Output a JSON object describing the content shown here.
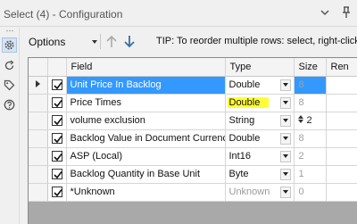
{
  "window": {
    "title": "Select (4) - Configuration"
  },
  "toolbar": {
    "options_label": "Options",
    "tip": "TIP: To reorder multiple rows: select, right-click an"
  },
  "grid": {
    "columns": [
      "Field",
      "Type",
      "Size",
      "Ren"
    ],
    "rows": [
      {
        "selected": true,
        "checked": true,
        "field": "Unit Price In Backlog",
        "type": "Double",
        "highlight": false,
        "type_disabled": false,
        "size": "8",
        "size_editable": false
      },
      {
        "selected": false,
        "checked": true,
        "field": "Price Times",
        "type": "Double",
        "highlight": true,
        "type_disabled": false,
        "size": "8",
        "size_editable": false
      },
      {
        "selected": false,
        "checked": true,
        "field": "volume exclusion",
        "type": "String",
        "highlight": false,
        "type_disabled": false,
        "size": "2",
        "size_editable": true
      },
      {
        "selected": false,
        "checked": true,
        "field": "Backlog Value in Document Currency",
        "type": "Double",
        "highlight": false,
        "type_disabled": false,
        "size": "8",
        "size_editable": false
      },
      {
        "selected": false,
        "checked": true,
        "field": "ASP (Local)",
        "type": "Int16",
        "highlight": false,
        "type_disabled": false,
        "size": "2",
        "size_editable": false
      },
      {
        "selected": false,
        "checked": true,
        "field": "Backlog Quantity in Base Unit",
        "type": "Byte",
        "highlight": false,
        "type_disabled": false,
        "size": "1",
        "size_editable": false
      },
      {
        "selected": false,
        "checked": true,
        "field": "*Unknown",
        "type": "Unknown",
        "highlight": false,
        "type_disabled": true,
        "size": "0",
        "size_editable": false
      }
    ]
  },
  "colors": {
    "selection": "#3399ff",
    "highlight": "#ffff33",
    "accent_icon": "#3a6ea5"
  },
  "icons": [
    "chevron-down-icon",
    "pin-icon",
    "gear-icon",
    "refresh-icon",
    "tag-icon",
    "help-icon",
    "arrow-up-icon",
    "arrow-down-icon",
    "checkmark-icon"
  ]
}
